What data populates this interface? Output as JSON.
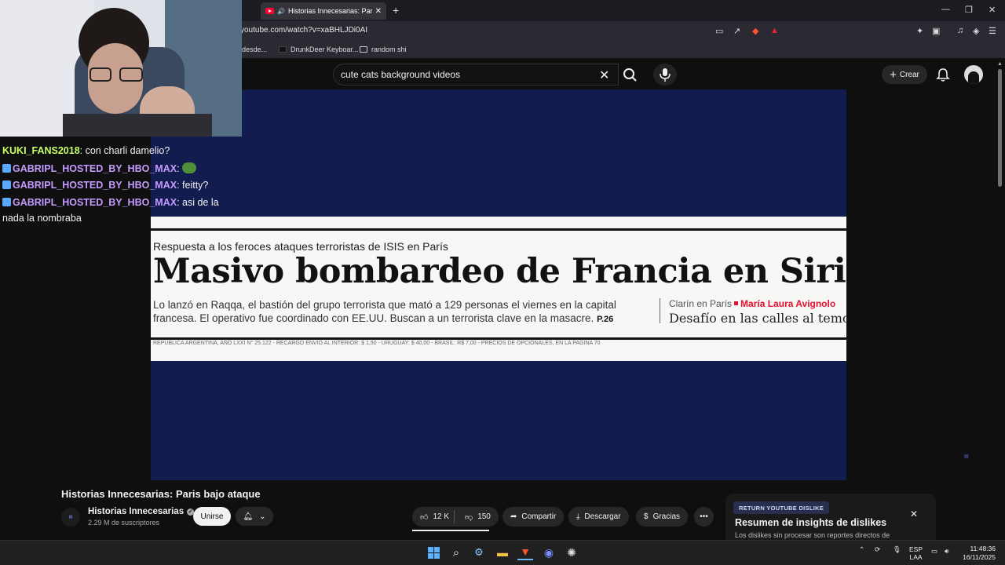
{
  "browser": {
    "tab_title": "Historias Innecesarias: Paris bajo ataque",
    "url": "youtube.com/watch?v=xaBHLJDi0AI",
    "bookmarks": [
      "desde...",
      "DrunkDeer Keyboar...",
      "random shi"
    ]
  },
  "youtube": {
    "search_query": "cute cats background videos",
    "create_label": "Crear"
  },
  "video_frame": {
    "kicker": "Respuesta a los feroces ataques terroristas de ISIS en París",
    "headline": "Masivo bombardeo de Francia en Siria",
    "subhead": "Lo lanzó en Raqqa, el bastión del grupo terrorista que mató a 129 personas el viernes en la capital francesa. El operativo fue coordinado con EE.UU. Buscan a un terrorista clave en la masacre.",
    "page_ref": "P.26",
    "byline_prefix": "Clarín en París",
    "byline_author": "María Laura Avignolo",
    "column_title": "Desafío en las calles al temor",
    "edition_line": "REPUBLICA ARGENTINA, AÑO LXXI N° 25.122 - RECARGO ENVIO AL INTERIOR: $ 1,50 - URUGUAY: $ 40,00 - BRASIL: R$ 7,00 - PRECIOS DE OPCIONALES, EN LA PAGINA 70"
  },
  "video": {
    "title": "Historias Innecesarias: Paris bajo ataque",
    "channel": "Historias Innecesarias",
    "subscribers": "2.29 M de suscriptores",
    "join_label": "Unirse",
    "likes": "12 K",
    "dislikes": "150",
    "share_label": "Compartir",
    "download_label": "Descargar",
    "thanks_label": "Gracias"
  },
  "ryd": {
    "badge": "RETURN YOUTUBE DISLIKE",
    "title": "Resumen de insights de dislikes",
    "text": "Los dislikes sin procesar son reportes directos de"
  },
  "chat": {
    "messages": [
      {
        "user": "KUKI_FANS2018",
        "text": ": con charli damelio?"
      },
      {
        "user": "GABRIPL_HOSTED_BY_HBO_MAX",
        "text": ":"
      },
      {
        "user": "GABRIPL_HOSTED_BY_HBO_MAX",
        "text": ": feitty?"
      },
      {
        "user": "GABRIPL_HOSTED_BY_HBO_MAX",
        "text": ": asi de la"
      }
    ],
    "wrap_text": "nada la nombraba"
  },
  "taskbar": {
    "lang_top": "ESP",
    "lang_bottom": "LAA",
    "time": "11:48:36",
    "date": "16/11/2025"
  },
  "colors": {
    "yt_red": "#ff0033",
    "headline_red": "#e2132f",
    "video_bg": "#131c4e"
  }
}
